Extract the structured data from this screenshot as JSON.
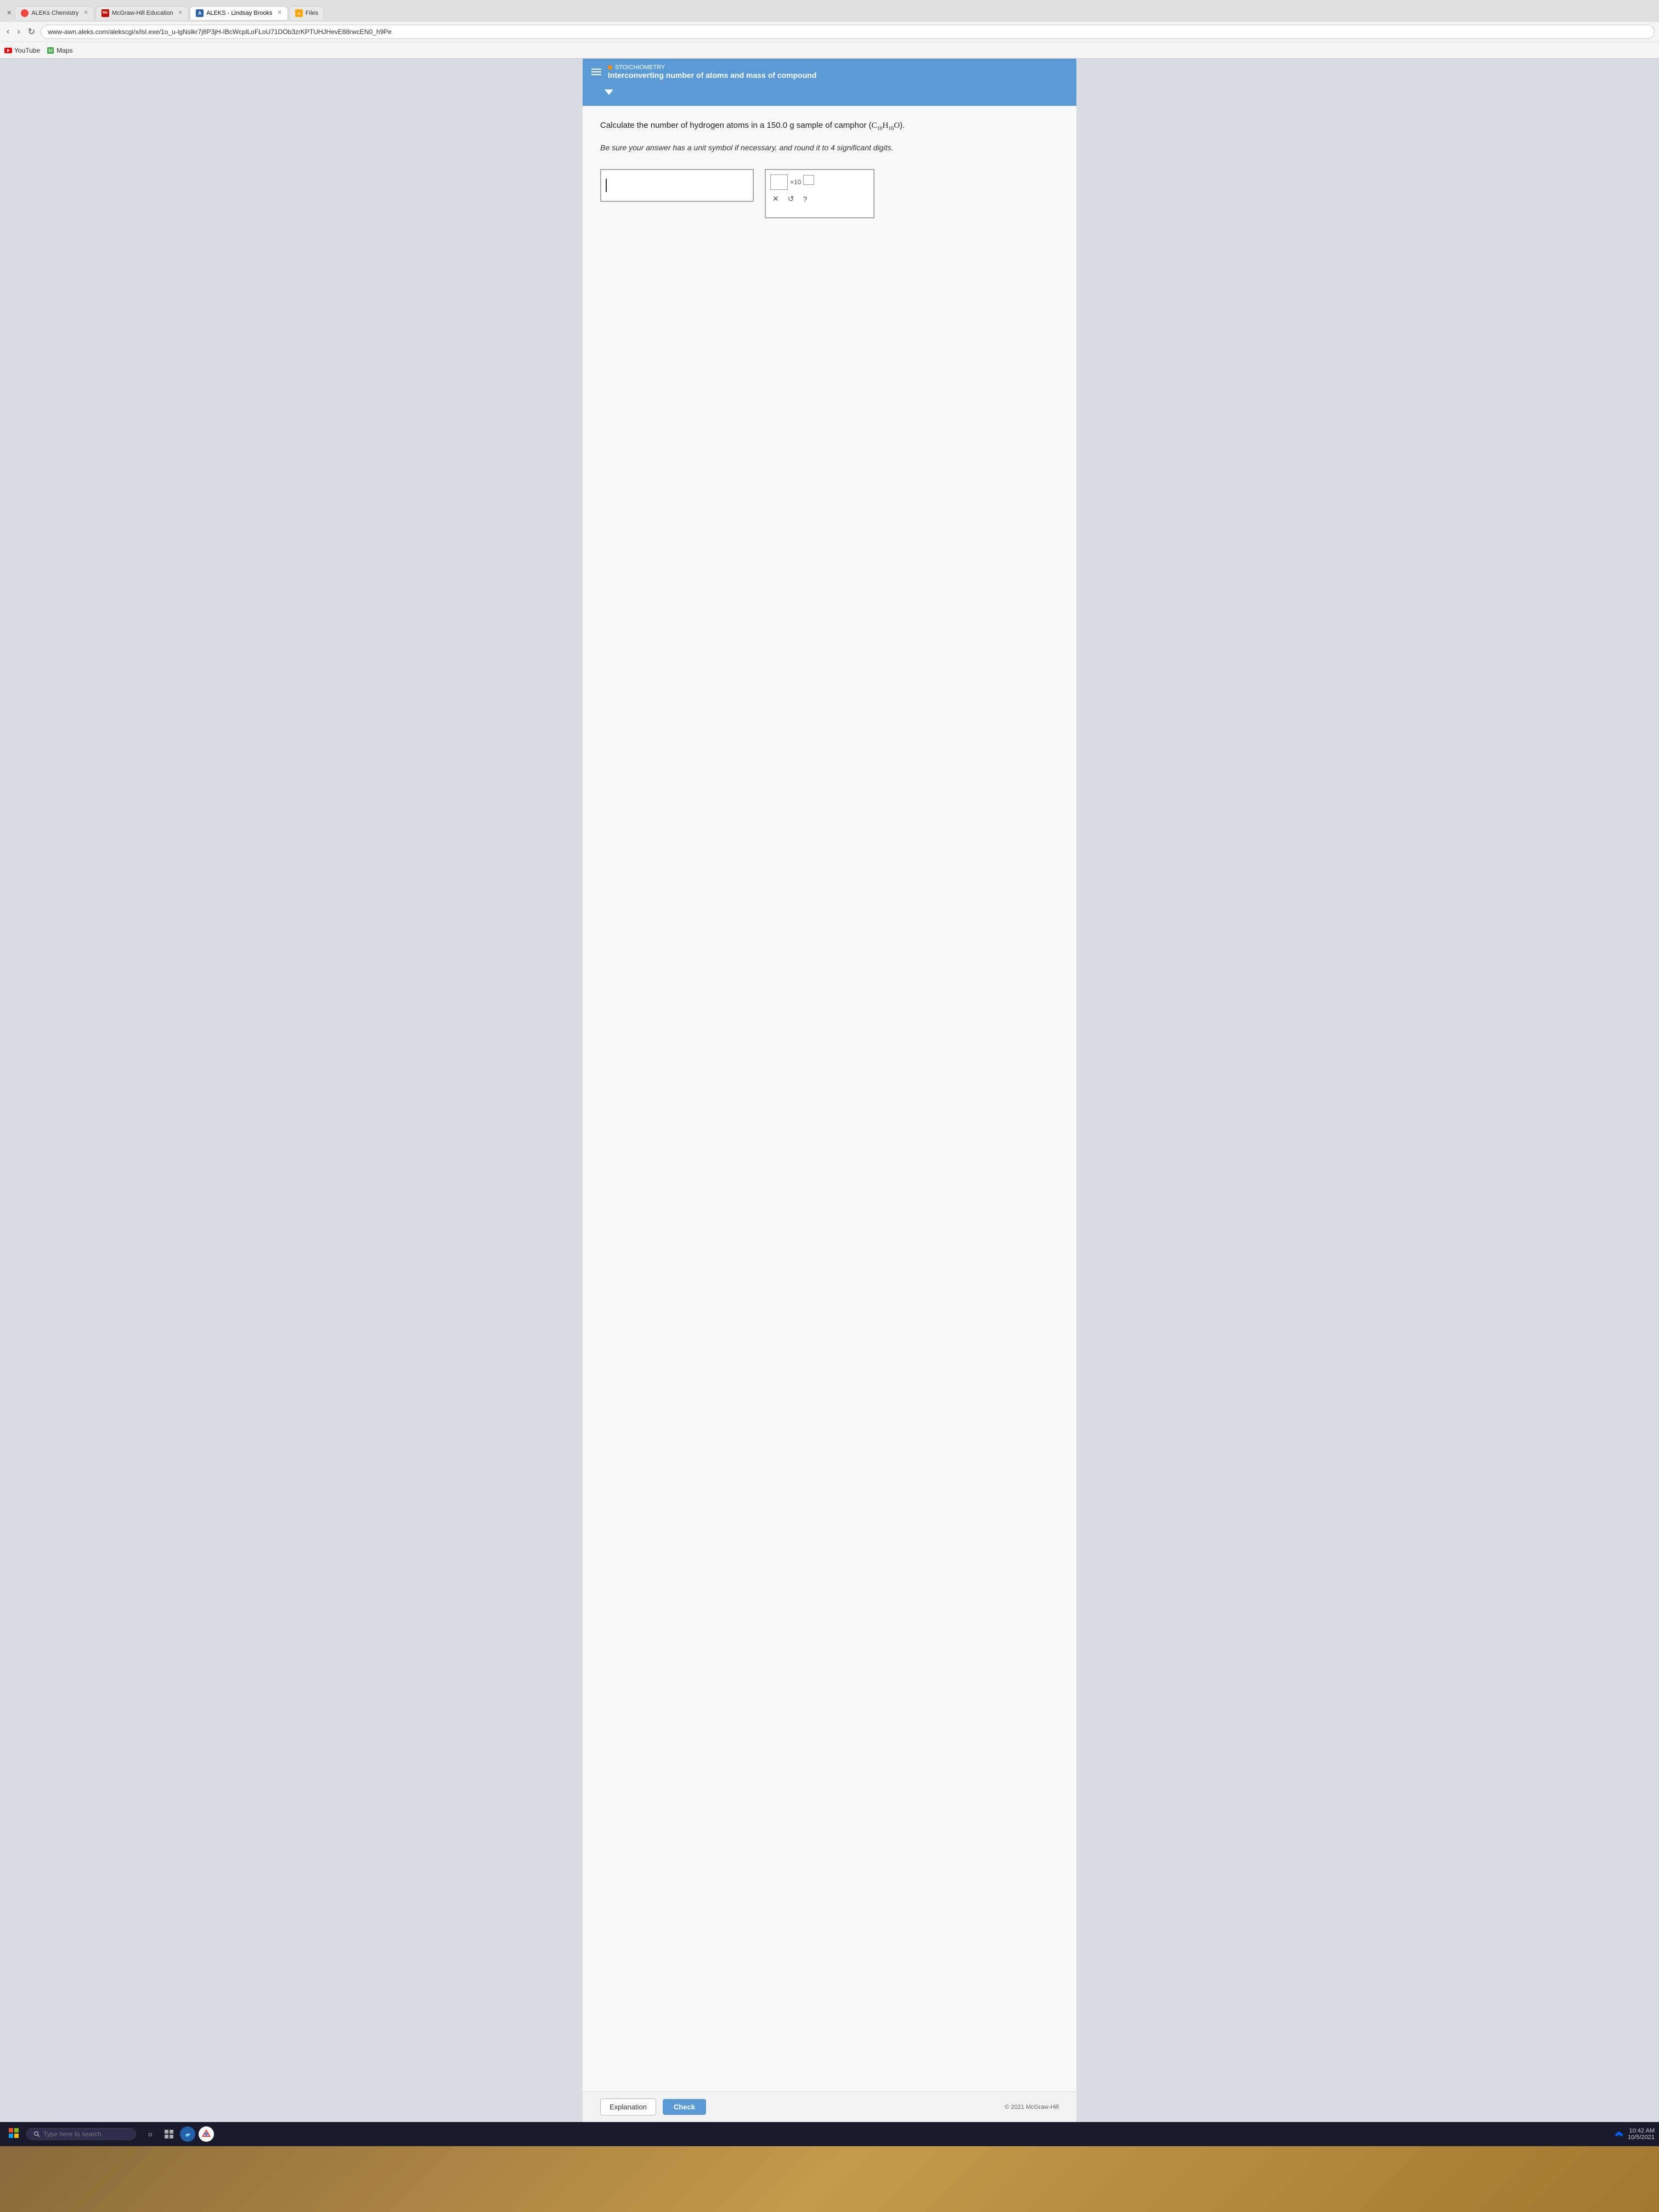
{
  "browser": {
    "tabs": [
      {
        "id": "tab-aleks",
        "label": "ALEKs Chemistry",
        "favicon": "aleks",
        "active": false,
        "closeable": true
      },
      {
        "id": "tab-mcgraw",
        "label": "McGraw-Hill Education",
        "favicon": "mcgraw",
        "active": false,
        "closeable": true
      },
      {
        "id": "tab-aleks-main",
        "label": "ALEKS - Lindsay Brooks",
        "favicon": "aleks2",
        "active": true,
        "closeable": true
      },
      {
        "id": "tab-files",
        "label": "Files",
        "favicon": "files",
        "active": false,
        "closeable": false
      }
    ],
    "address": "www-awn.aleks.com/alekscgi/x/lsl.exe/1o_u-lgNslkr7j8P3jH-IBcWcplLoFLoU71DOb3zrKPTUHJHevE88rwcEN0_h9Pe",
    "bookmarks": [
      {
        "label": "YouTube",
        "icon": "youtube"
      },
      {
        "label": "Maps",
        "icon": "maps"
      }
    ]
  },
  "aleks": {
    "section_label": "STOICHIOMETRY",
    "topic_title": "Interconverting number of atoms and mass of compound",
    "question": "Calculate the number of hydrogen atoms in a 150.0 g sample of camphor (C₁₀H₁₆O).",
    "instruction": "Be sure your answer has a unit symbol if necessary, and round it to 4 significant digits.",
    "input_placeholder": "",
    "sci_notation_label": "×10",
    "buttons": {
      "explanation": "Explanation",
      "check": "Check"
    },
    "copyright": "© 2021 McGraw-Hill"
  },
  "taskbar": {
    "search_placeholder": "Type here to search"
  }
}
